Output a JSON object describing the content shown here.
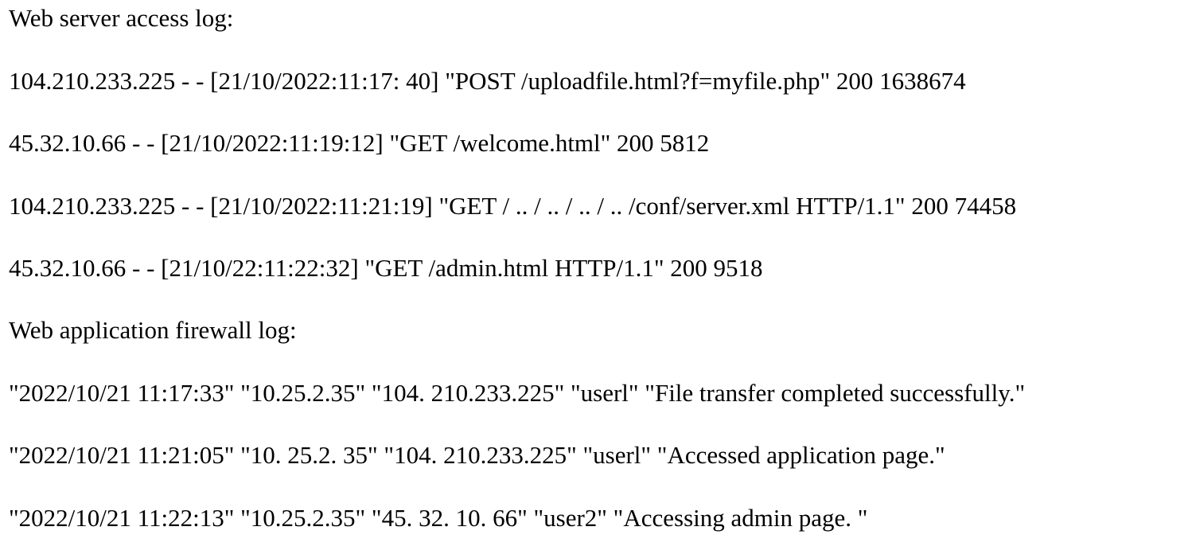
{
  "web_server_log": {
    "heading": "Web server access log:",
    "entries": [
      "104.210.233.225 - - [21/10/2022:11:17: 40] \"POST /uploadfile.html?f=myfile.php\" 200 1638674",
      "45.32.10.66 - - [21/10/2022:11:19:12] \"GET /welcome.html\" 200 5812",
      "104.210.233.225 - - [21/10/2022:11:21:19] \"GET / .. / .. / .. / .. /conf/server.xml HTTP/1.1\" 200 74458",
      "45.32.10.66 - - [21/10/22:11:22:32] \"GET /admin.html HTTP/1.1\" 200 9518"
    ]
  },
  "waf_log": {
    "heading": "Web application firewall log:",
    "entries": [
      "\"2022/10/21 11:17:33\" \"10.25.2.35\" \"104. 210.233.225\" \"userl\" \"File transfer completed successfully.\"",
      "\"2022/10/21 11:21:05\" \"10. 25.2. 35\" \"104. 210.233.225\" \"userl\" \"Accessed application page.\"",
      "\"2022/10/21 11:22:13\" \"10.25.2.35\" \"45. 32. 10. 66\" \"user2\" \"Accessing admin page. \""
    ]
  }
}
